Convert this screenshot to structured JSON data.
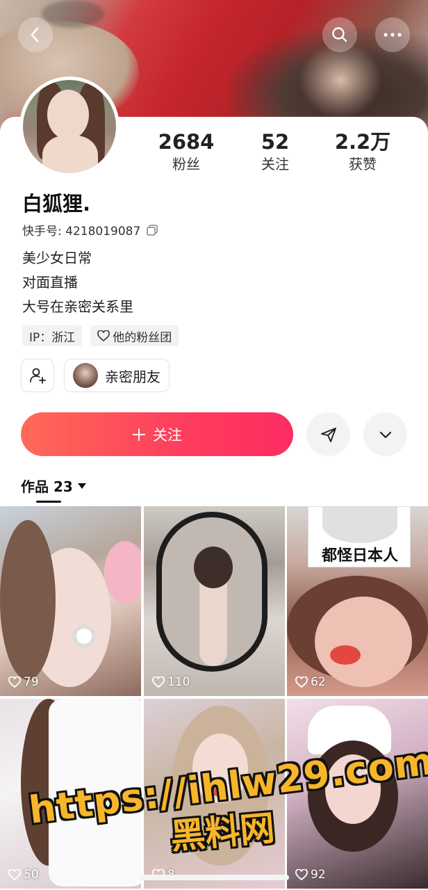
{
  "header": {
    "back_icon": "chevron-left-icon",
    "search_icon": "search-icon",
    "more_icon": "more-horizontal-icon"
  },
  "profile": {
    "nickname": "白狐狸.",
    "kuaishou_id_label": "快手号: 4218019087",
    "bio": [
      "美少女日常",
      "对面直播",
      "大号在亲密关系里"
    ],
    "stats": {
      "fans_value": "2684",
      "fans_label": "粉丝",
      "following_value": "52",
      "following_label": "关注",
      "likes_value": "2.2万",
      "likes_label": "获赞"
    },
    "tags": {
      "ip": "IP：浙江",
      "fan_group": "他的粉丝团"
    },
    "intimate_friend_label": "亲密朋友"
  },
  "actions": {
    "follow_label": "关注",
    "share_icon": "send-icon",
    "expand_icon": "chevron-down-icon"
  },
  "works": {
    "tab_label": "作品 23",
    "items": [
      {
        "likes": "79"
      },
      {
        "likes": "110"
      },
      {
        "likes": "62",
        "caption": "都怪日本人"
      },
      {
        "likes": "50"
      },
      {
        "likes": "8"
      },
      {
        "likes": "92"
      }
    ]
  },
  "watermark": {
    "url": "https://ihlw29.com",
    "name": "黑料网"
  },
  "colors": {
    "follow_gradient_start": "#ff6a57",
    "follow_gradient_end": "#fd2c61"
  }
}
